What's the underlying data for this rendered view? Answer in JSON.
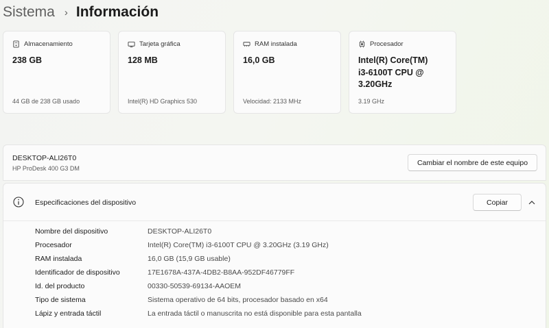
{
  "breadcrumb": {
    "parent": "Sistema",
    "separator": "›",
    "current": "Información"
  },
  "cards": [
    {
      "title": "Almacenamiento",
      "value": "238 GB",
      "sub": "44 GB de 238 GB usado",
      "icon": "storage-icon"
    },
    {
      "title": "Tarjeta gráfica",
      "value": "128 MB",
      "sub": "Intel(R) HD Graphics 530",
      "icon": "gpu-icon"
    },
    {
      "title": "RAM instalada",
      "value": "16,0 GB",
      "sub": "Velocidad: 2133 MHz",
      "icon": "ram-icon"
    },
    {
      "title": "Procesador",
      "value": "Intel(R) Core(TM) i3-6100T CPU @ 3.20GHz",
      "sub": "3.19 GHz",
      "icon": "processor-icon"
    }
  ],
  "device": {
    "name": "DESKTOP-ALI26T0",
    "model": "HP ProDesk 400 G3 DM",
    "rename_label": "Cambiar el nombre de este equipo"
  },
  "specs": {
    "title": "Especificaciones del dispositivo",
    "copy_label": "Copiar",
    "rows": [
      {
        "label": "Nombre del dispositivo",
        "value": "DESKTOP-ALI26T0"
      },
      {
        "label": "Procesador",
        "value": "Intel(R) Core(TM) i3-6100T CPU @ 3.20GHz (3.19 GHz)"
      },
      {
        "label": "RAM instalada",
        "value": "16,0 GB (15,9 GB usable)"
      },
      {
        "label": "Identificador de dispositivo",
        "value": "17E1678A-437A-4DB2-B8AA-952DF46779FF"
      },
      {
        "label": "Id. del producto",
        "value": "00330-50539-69134-AAOEM"
      },
      {
        "label": "Tipo de sistema",
        "value": "Sistema operativo de 64 bits, procesador basado en x64"
      },
      {
        "label": "Lápiz y entrada táctil",
        "value": "La entrada táctil o manuscrita no está disponible para esta pantalla"
      }
    ]
  }
}
